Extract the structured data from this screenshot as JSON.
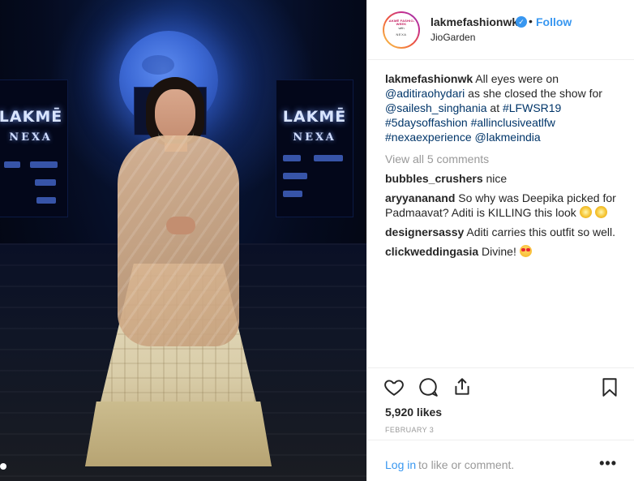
{
  "photo": {
    "board_brand": "LAKMĒ",
    "board_sub": "NEXA"
  },
  "header": {
    "username": "lakmefashionwk",
    "dot": "•",
    "follow_label": "Follow",
    "location": "JioGarden",
    "avatar_lines": [
      "LAKMĒ FASHION WEEK",
      "with",
      "NEXA"
    ]
  },
  "caption": {
    "username": "lakmefashionwk",
    "text_1": " All eyes were on ",
    "mention_1": "@aditiraohydari",
    "text_2": " as she closed the show for ",
    "mention_2": "@sailesh_singhania",
    "text_3": " at ",
    "tag_1": "#LFWSR19",
    "tag_2": "#5daysoffashion",
    "tag_3": "#allinclusiveatlfw",
    "tag_4": "#nexaexperience",
    "mention_3": "@lakmeindia"
  },
  "view_all": "View all 5 comments",
  "comments": [
    {
      "user": "bubbles_crushers",
      "text": " nice"
    },
    {
      "user": "aryyananand",
      "text": " So why was Deepika picked for Padmaavat? Aditi is KILLING this look "
    },
    {
      "user": "designersassy",
      "text": " Aditi carries this outfit so well."
    },
    {
      "user": "clickweddingasia",
      "text": " Divine! "
    }
  ],
  "icons": {
    "like": "heart-icon",
    "comment": "comment-icon",
    "share": "share-icon",
    "save": "bookmark-icon",
    "more": "more-icon"
  },
  "likes": "5,920 likes",
  "date": "FEBRUARY 3",
  "login": {
    "link": "Log in",
    "rest": " to like or comment.",
    "more": "•••"
  },
  "colors": {
    "link": "#3897f0",
    "hashtag": "#003569",
    "muted": "#999999"
  }
}
